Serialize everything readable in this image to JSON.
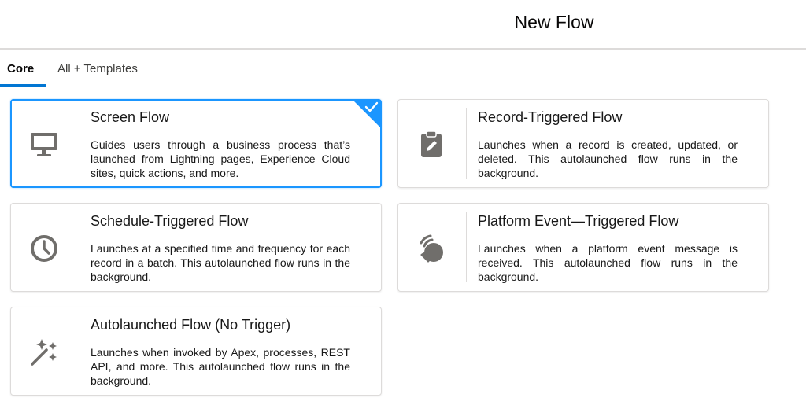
{
  "header": {
    "title": "New Flow"
  },
  "tabs": [
    {
      "label": "Core",
      "active": true
    },
    {
      "label": "All + Templates",
      "active": false
    }
  ],
  "cards": [
    {
      "title": "Screen Flow",
      "description": "Guides users through a business process that’s launched from Lightning pages, Experience Cloud sites, quick actions, and more.",
      "icon": "monitor-icon",
      "selected": true
    },
    {
      "title": "Record-Triggered Flow",
      "description": "Launches when a record is created, updated, or deleted. This autolaunched flow runs in the background.",
      "icon": "clipboard-edit-icon",
      "selected": false
    },
    {
      "title": "Schedule-Triggered Flow",
      "description": "Launches at a specified time and frequency for each record in a batch. This autolaunched flow runs in the background.",
      "icon": "clock-icon",
      "selected": false
    },
    {
      "title": "Platform Event—Triggered Flow",
      "description": "Launches when a platform event message is received. This autolaunched flow runs in the background.",
      "icon": "platform-event-icon",
      "selected": false
    },
    {
      "title": "Autolaunched Flow (No Trigger)",
      "description": "Launches when invoked by Apex, processes, REST API, and more. This autolaunched flow runs in the background.",
      "icon": "magic-wand-icon",
      "selected": false
    }
  ],
  "colors": {
    "accent": "#1b96ff",
    "icon": "#706e6b",
    "border": "#dddbda",
    "tab_underline": "#0176d3"
  }
}
